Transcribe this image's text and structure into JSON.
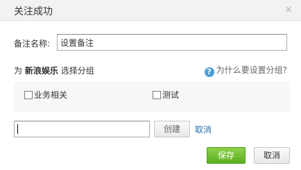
{
  "dialog": {
    "title": "关注成功",
    "close_glyph": "×",
    "close_icon": "close-icon"
  },
  "remark": {
    "label": "备注名称:",
    "value": "设置备注"
  },
  "group_section": {
    "prefix": "为",
    "user_name": "新浪娱乐",
    "suffix": "选择分组",
    "help_icon_glyph": "?",
    "help_icon": "question-circle-icon",
    "help_text": "为什么要设置分组?",
    "groups": [
      {
        "label": "业务相关",
        "checked": false
      },
      {
        "label": "测试",
        "checked": false
      }
    ]
  },
  "new_group": {
    "value": "",
    "create_label": "创建",
    "cancel_label": "取消"
  },
  "footer": {
    "save_label": "保存",
    "cancel_label": "取消"
  },
  "colors": {
    "accent_green": "#6cbf2a",
    "link_blue": "#2a6db0",
    "help_blue": "#4a9fd8"
  }
}
